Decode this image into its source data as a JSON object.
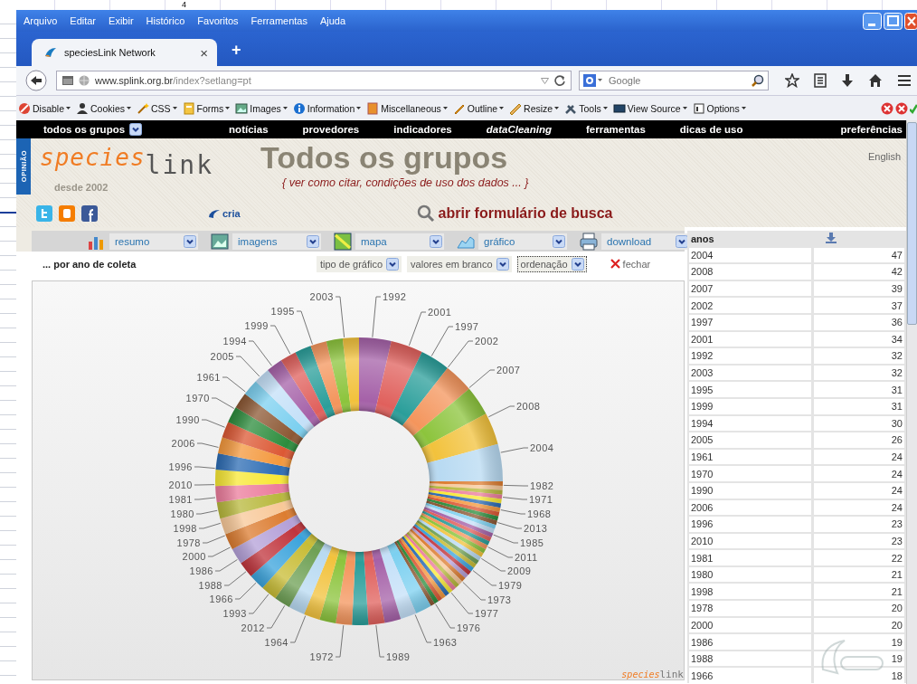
{
  "background_window": {
    "cell_text": "4"
  },
  "menu_bar": [
    "Arquivo",
    "Editar",
    "Exibir",
    "Histórico",
    "Favoritos",
    "Ferramentas",
    "Ajuda"
  ],
  "tabs": [
    {
      "label": "speciesLink Network",
      "selected": true,
      "close": "×"
    }
  ],
  "new_tab": "+",
  "address_bar": {
    "domain": "www.splink.org.br",
    "path": "/index?setlang=pt"
  },
  "search_box": {
    "placeholder": "Google"
  },
  "dev_toolbar": [
    "Disable",
    "Cookies",
    "CSS",
    "Forms",
    "Images",
    "Information",
    "Miscellaneous",
    "Outline",
    "Resize",
    "Tools",
    "View Source",
    "Options"
  ],
  "site_nav": [
    {
      "label": "todos os grupos",
      "kind": "dropdown"
    },
    {
      "label": "notícias",
      "kind": "link"
    },
    {
      "label": "provedores",
      "kind": "link"
    },
    {
      "label": "indicadores",
      "kind": "link"
    },
    {
      "label": "dataCleaning",
      "kind": "featured"
    },
    {
      "label": "ferramentas",
      "kind": "link"
    },
    {
      "label": "dicas de uso",
      "kind": "link"
    },
    {
      "label": "preferências",
      "kind": "link"
    }
  ],
  "side_tab": "OPINIÃO",
  "header": {
    "logo_species": "species",
    "logo_link": "link",
    "since": "desde 2002",
    "title": "Todos os grupos",
    "citation": "{ ver como citar, condições de uso dos dados ... }",
    "language": "English",
    "partner_logo": "cria",
    "search_link": "abrir formulário de busca"
  },
  "view_selects": [
    {
      "label": "resumo",
      "kind": "summary"
    },
    {
      "label": "imagens",
      "kind": "images"
    },
    {
      "label": "mapa",
      "kind": "map"
    },
    {
      "label": "gráfico",
      "kind": "chart"
    },
    {
      "label": "download",
      "kind": "download"
    }
  ],
  "panel": {
    "title": "... por ano de coleta",
    "options": [
      {
        "label": "tipo de gráfico",
        "focused": false
      },
      {
        "label": "valores em branco",
        "focused": false
      },
      {
        "label": "ordenação",
        "focused": true
      }
    ],
    "close": "fechar"
  },
  "donut_chart": {
    "labels": [
      "2003",
      "1995",
      "1999",
      "1994",
      "2005",
      "1961",
      "1970",
      "1990",
      "2006",
      "1996",
      "2010",
      "1981",
      "1980",
      "1998",
      "1978",
      "2000",
      "1986",
      "1988",
      "1966",
      "1993",
      "2012",
      "1964",
      "1972",
      "1992",
      "2001",
      "1997",
      "2002",
      "2007",
      "2008",
      "2004",
      "1982",
      "1971",
      "1968",
      "2013",
      "1985",
      "2011",
      "2009",
      "1979",
      "1973",
      "1977",
      "1976",
      "1963",
      "1989"
    ],
    "watermark_species": "species",
    "watermark_link": "link"
  },
  "table": {
    "columns": [
      "anos"
    ],
    "rows": [
      {
        "year": "2004",
        "count": "47"
      },
      {
        "year": "2008",
        "count": "42"
      },
      {
        "year": "2007",
        "count": "39"
      },
      {
        "year": "2002",
        "count": "37"
      },
      {
        "year": "1997",
        "count": "36"
      },
      {
        "year": "2001",
        "count": "34"
      },
      {
        "year": "1992",
        "count": "32"
      },
      {
        "year": "2003",
        "count": "32"
      },
      {
        "year": "1995",
        "count": "31"
      },
      {
        "year": "1999",
        "count": "31"
      },
      {
        "year": "1994",
        "count": "30"
      },
      {
        "year": "2005",
        "count": "26"
      },
      {
        "year": "1961",
        "count": "24"
      },
      {
        "year": "1970",
        "count": "24"
      },
      {
        "year": "1990",
        "count": "24"
      },
      {
        "year": "2006",
        "count": "24"
      },
      {
        "year": "1996",
        "count": "23"
      },
      {
        "year": "2010",
        "count": "23"
      },
      {
        "year": "1981",
        "count": "22"
      },
      {
        "year": "1980",
        "count": "21"
      },
      {
        "year": "1998",
        "count": "21"
      },
      {
        "year": "1978",
        "count": "20"
      },
      {
        "year": "2000",
        "count": "20"
      },
      {
        "year": "1986",
        "count": "19"
      },
      {
        "year": "1988",
        "count": "19"
      },
      {
        "year": "1966",
        "count": "18"
      }
    ]
  }
}
